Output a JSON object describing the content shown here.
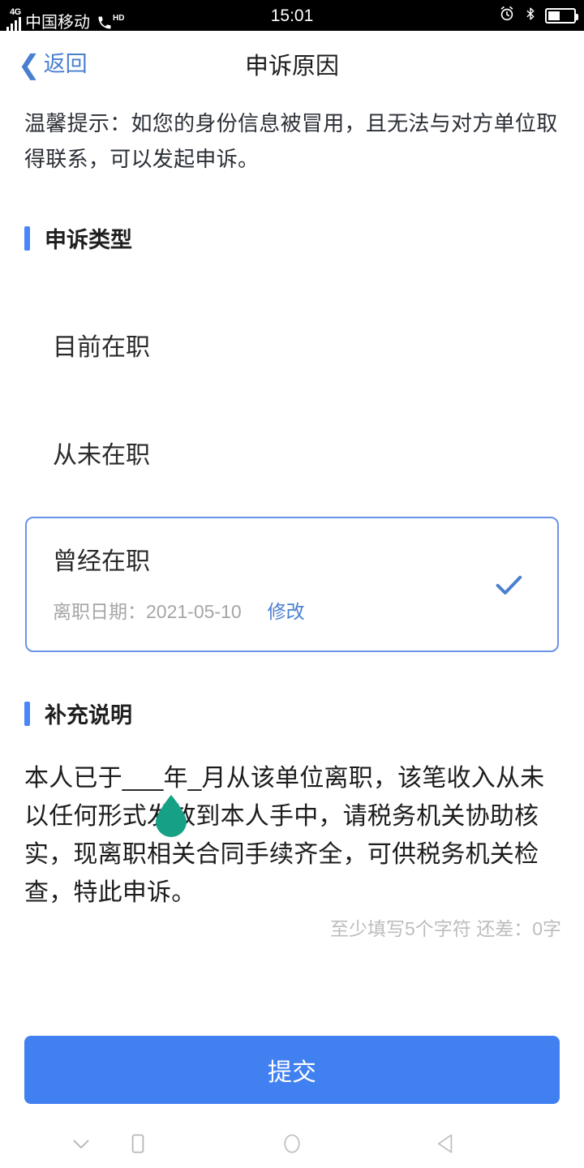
{
  "statusbar": {
    "network_tag": "4G",
    "carrier": "中国移动",
    "voice_icon": "phone-hd-icon",
    "hd_label": "HD",
    "time": "15:01",
    "alarm_icon": "alarm-clock-icon",
    "bluetooth_icon": "bluetooth-icon",
    "battery_icon": "battery-icon"
  },
  "navbar": {
    "back_icon": "chevron-left-icon",
    "back_label": "返回",
    "title": "申诉原因"
  },
  "tip": {
    "text": "温馨提示：如您的身份信息被冒用，且无法与对方单位取得联系，可以发起申诉。"
  },
  "appeal_type": {
    "section_title": "申诉类型",
    "options": [
      {
        "label": "目前在职",
        "selected": false
      },
      {
        "label": "从未在职",
        "selected": false
      }
    ],
    "selected_card": {
      "label": "曾经在职",
      "detail_label": "离职日期：",
      "detail_value": "2021-05-10",
      "edit_label": "修改",
      "check_icon": "check-icon",
      "selected": true
    }
  },
  "supplement": {
    "section_title": "补充说明",
    "text": "本人已于___年_月从该单位离职，该笔收入从未以任何形式发放到本人手中，请税务机关协助核实，现离职相关合同手续齐全，可供税务机关检查，特此申诉。",
    "cursor_handle_icon": "text-cursor-drop-handle",
    "char_hint": "至少填写5个字符 还差：0字"
  },
  "submit": {
    "label": "提交"
  },
  "androidnav": {
    "items": [
      {
        "icon": "chevron-down-icon"
      },
      {
        "icon": "square-recents-icon"
      },
      {
        "icon": "circle-home-icon"
      },
      {
        "icon": "triangle-back-icon"
      }
    ]
  },
  "colors": {
    "accent_blue": "#4a86f7",
    "link_blue": "#4a7fd0",
    "submit_blue": "#4080f0",
    "card_border": "#6a93e8",
    "muted_gray": "#a6a6a6",
    "hint_gray": "#bdbdbd",
    "cursor_teal": "#16a085"
  }
}
